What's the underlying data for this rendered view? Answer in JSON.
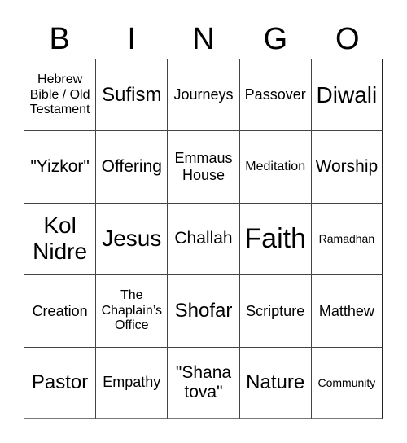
{
  "header": [
    "B",
    "I",
    "N",
    "G",
    "O"
  ],
  "cells": [
    {
      "text": "Hebrew Bible / Old Testament",
      "size": "s-sm"
    },
    {
      "text": "Sufism",
      "size": "s-xl"
    },
    {
      "text": "Journeys",
      "size": "s-md"
    },
    {
      "text": "Passover",
      "size": "s-md"
    },
    {
      "text": "Diwali",
      "size": "s-xxl"
    },
    {
      "text": "\"Yizkor\"",
      "size": "s-lg"
    },
    {
      "text": "Offering",
      "size": "s-lg"
    },
    {
      "text": "Emmaus House",
      "size": "s-md"
    },
    {
      "text": "Meditation",
      "size": "s-sm"
    },
    {
      "text": "Worship",
      "size": "s-lg"
    },
    {
      "text": "Kol Nidre",
      "size": "s-xxl"
    },
    {
      "text": "Jesus",
      "size": "s-xxl"
    },
    {
      "text": "Challah",
      "size": "s-lg"
    },
    {
      "text": "Faith",
      "size": "s-xxxl"
    },
    {
      "text": "Ramadhan",
      "size": "s-xs"
    },
    {
      "text": "Creation",
      "size": "s-md"
    },
    {
      "text": "The Chaplain’s Office",
      "size": "s-sm"
    },
    {
      "text": "Shofar",
      "size": "s-xl"
    },
    {
      "text": "Scripture",
      "size": "s-md"
    },
    {
      "text": "Matthew",
      "size": "s-md"
    },
    {
      "text": "Pastor",
      "size": "s-xl"
    },
    {
      "text": "Empathy",
      "size": "s-md"
    },
    {
      "text": "\"Shana tova\"",
      "size": "s-lg"
    },
    {
      "text": "Nature",
      "size": "s-xl"
    },
    {
      "text": "Community",
      "size": "s-xs"
    }
  ]
}
